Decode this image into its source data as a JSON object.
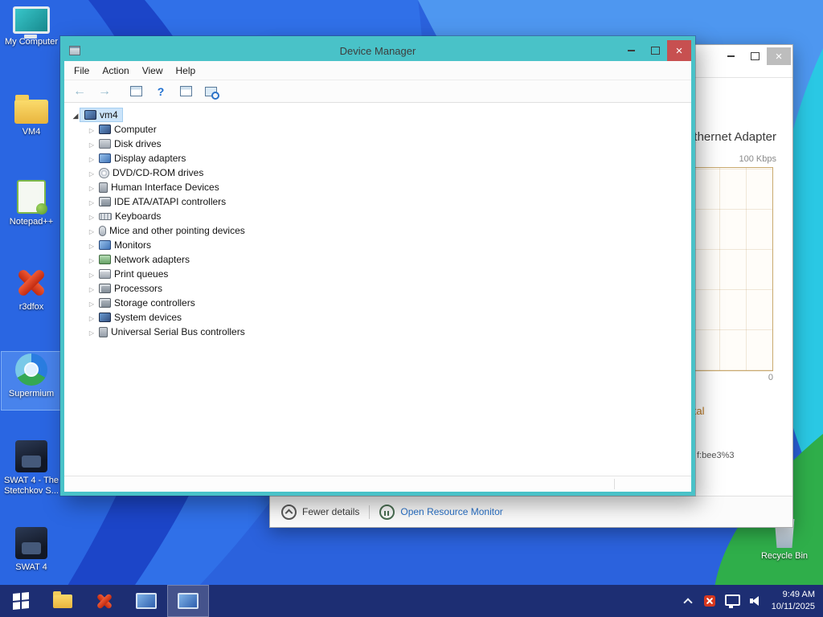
{
  "colors": {
    "device_manager_border": "#49c2c8",
    "close_button_red": "#c75050",
    "taskbar_blue": "#1d2e73",
    "tree_selection_blue": "#cbe4fa",
    "link_blue": "#2a72c8",
    "ethernet_chart_tan": "#c9a96e",
    "wallpaper_base_blue": "#2b6be0",
    "wallpaper_dark_blue": "#1c45c8",
    "wallpaper_light_blue": "#4e97f0",
    "wallpaper_cyan": "#2ac8e4",
    "wallpaper_green": "#2fae4a"
  },
  "device_manager": {
    "title": "Device Manager",
    "menu_items": [
      "File",
      "Action",
      "View",
      "Help"
    ],
    "toolbar_icons": [
      "back-icon",
      "forward-icon",
      "console-tree-icon",
      "help-icon",
      "properties-icon",
      "scan-hardware-changes-icon"
    ],
    "tree_root_label": "vm4",
    "tree_items": [
      {
        "label": "Computer",
        "icon": "computer-icon"
      },
      {
        "label": "Disk drives",
        "icon": "disk-drive-icon"
      },
      {
        "label": "Display adapters",
        "icon": "display-adapter-icon"
      },
      {
        "label": "DVD/CD-ROM drives",
        "icon": "dvd-drive-icon"
      },
      {
        "label": "Human Interface Devices",
        "icon": "hid-icon"
      },
      {
        "label": "IDE ATA/ATAPI controllers",
        "icon": "ide-controller-icon"
      },
      {
        "label": "Keyboards",
        "icon": "keyboard-icon"
      },
      {
        "label": "Mice and other pointing devices",
        "icon": "mouse-icon"
      },
      {
        "label": "Monitors",
        "icon": "monitor-icon"
      },
      {
        "label": "Network adapters",
        "icon": "network-adapter-icon"
      },
      {
        "label": "Print queues",
        "icon": "print-queue-icon"
      },
      {
        "label": "Processors",
        "icon": "processor-icon"
      },
      {
        "label": "Storage controllers",
        "icon": "storage-controller-icon"
      },
      {
        "label": "System devices",
        "icon": "system-device-icon"
      },
      {
        "label": "Universal Serial Bus controllers",
        "icon": "usb-controller-icon"
      }
    ]
  },
  "task_manager": {
    "adapter_name": "Ethernet Adapter",
    "chart": {
      "type": "line",
      "y_max_label": "100 Kbps",
      "y_min_label": "0",
      "values": []
    },
    "total_label": "Total",
    "ipv6_fragment": "f:bee3%3",
    "fewer_details_label": "Fewer details",
    "open_resource_monitor_label": "Open Resource Monitor"
  },
  "desktop": {
    "icons": [
      {
        "label": "My Computer",
        "icon": "my-computer-icon",
        "selected": false
      },
      {
        "label": "VM4",
        "icon": "folder-icon",
        "selected": false
      },
      {
        "label": "Notepad++",
        "icon": "notepadpp-icon",
        "selected": false
      },
      {
        "label": "r3dfox",
        "icon": "r3dfox-icon",
        "selected": false
      },
      {
        "label": "Supermium",
        "icon": "supermium-icon",
        "selected": true
      },
      {
        "label": "SWAT 4 - The Stetchkov S...",
        "icon": "swat4-icon",
        "selected": false
      },
      {
        "label": "SWAT 4",
        "icon": "swat4-icon",
        "selected": false
      }
    ],
    "recycle_bin_label": "Recycle Bin"
  },
  "taskbar": {
    "buttons": [
      {
        "name": "start-button",
        "icon": "windows-logo-icon",
        "active": false
      },
      {
        "name": "file-explorer-button",
        "icon": "folder-icon",
        "active": false
      },
      {
        "name": "r3dfox-button",
        "icon": "r3dfox-icon",
        "active": false
      },
      {
        "name": "app-window-button",
        "icon": "app-window-icon",
        "active": false
      },
      {
        "name": "device-manager-button",
        "icon": "app-window-icon",
        "active": true
      }
    ],
    "tray_icons": [
      "hidden-icons-chevron",
      "r3dfox-tray-icon",
      "network-tray-icon",
      "volume-tray-icon"
    ],
    "clock_time": "9:49 AM",
    "clock_date": "10/11/2025"
  }
}
